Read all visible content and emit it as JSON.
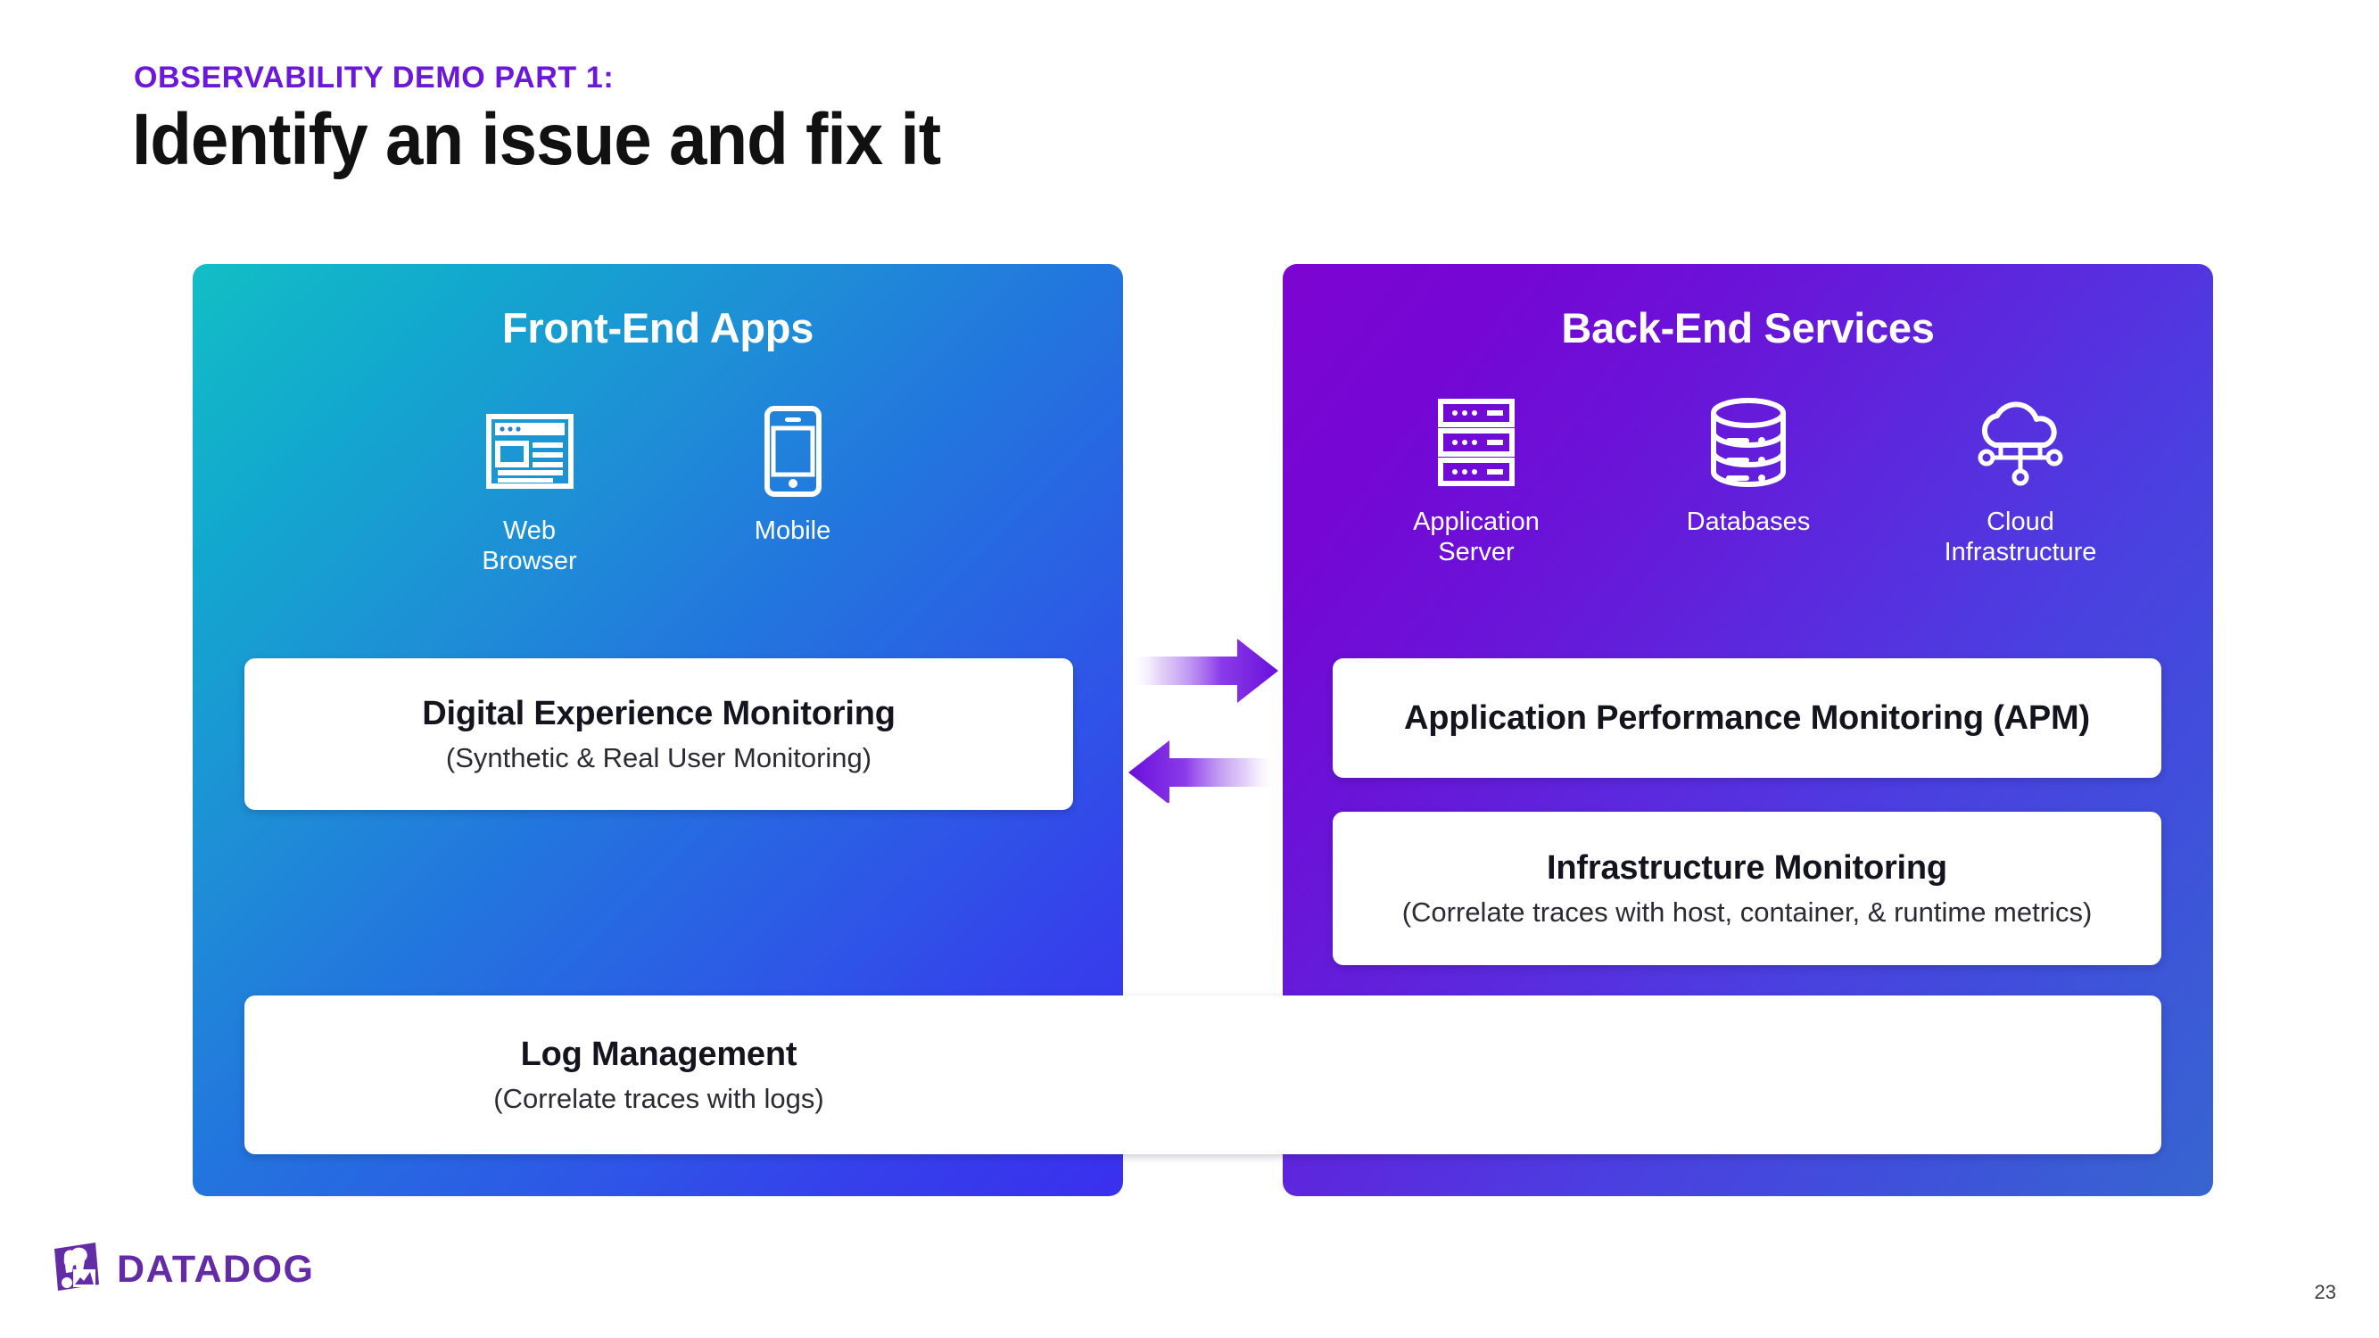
{
  "header": {
    "eyebrow": "OBSERVABILITY DEMO PART 1:",
    "title": "Identify an issue and fix it"
  },
  "colors": {
    "eyebrow_purple": "#6B18DB",
    "left_panel_start": "#12BEC5",
    "left_panel_end": "#3A2FEE",
    "right_panel_start": "#7D05D2",
    "right_panel_end": "#3765D0",
    "arrow_purple": "#7A1BE0",
    "logo_purple": "#632CA6",
    "card_background": "#FFFFFF"
  },
  "left_panel": {
    "heading": "Front-End Apps",
    "icons": [
      {
        "icon": "web-browser-icon",
        "label": "Web Browser"
      },
      {
        "icon": "mobile-phone-icon",
        "label": "Mobile"
      }
    ],
    "card": {
      "title": "Digital Experience Monitoring",
      "subtitle": "(Synthetic & Real User Monitoring)"
    }
  },
  "right_panel": {
    "heading": "Back-End Services",
    "icons": [
      {
        "icon": "server-rack-icon",
        "label": "Application Server"
      },
      {
        "icon": "database-icon",
        "label": "Databases"
      },
      {
        "icon": "cloud-network-icon",
        "label": "Cloud\nInfrastructure"
      }
    ],
    "cards": [
      {
        "title": "Application Performance Monitoring (APM)",
        "subtitle": ""
      },
      {
        "title": "Infrastructure Monitoring",
        "subtitle": "(Correlate traces with host, container, & runtime metrics)"
      }
    ]
  },
  "bottom_card": {
    "title": "Log Management",
    "subtitle": "(Correlate traces with logs)"
  },
  "arrows": [
    {
      "name": "arrow-right",
      "direction": "right"
    },
    {
      "name": "arrow-left",
      "direction": "left"
    }
  ],
  "footer": {
    "logo_text": "DATADOG",
    "page_number": "23"
  }
}
